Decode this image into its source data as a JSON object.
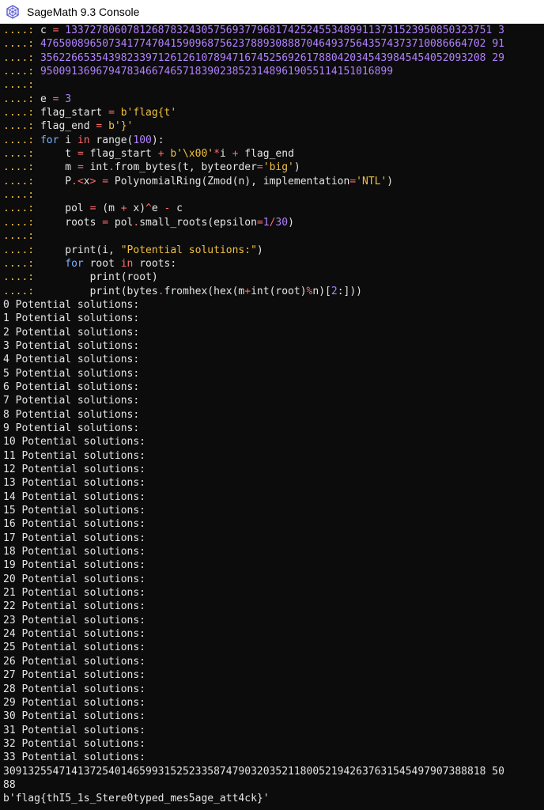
{
  "window": {
    "title": "SageMath 9.3 Console",
    "icon": "sagemath-icon"
  },
  "colors": {
    "background": "#0c0c0c",
    "text": "#e6e6e6",
    "prompt": "#f0c040",
    "number": "#b281ff",
    "string": "#f0c040",
    "keyword": "#7fb2ff",
    "operator": "#ff6b6b"
  },
  "console_lines": [
    {
      "prompt": "....: ",
      "tokens": [
        [
          "ident",
          "c "
        ],
        [
          "op",
          "="
        ],
        [
          "ident",
          " "
        ],
        [
          "num",
          "133727806078126878324305756937796817425245534899113731523950850323751 3"
        ]
      ]
    },
    {
      "prompt": "....: ",
      "tokens": [
        [
          "num",
          "476500896507341774704159096875623788930888704649375643574373710086664702 91"
        ]
      ]
    },
    {
      "prompt": "....: ",
      "tokens": [
        [
          "num",
          "356226653543982339712612610789471674525692617880420345439845454052093208 29"
        ]
      ]
    },
    {
      "prompt": "....: ",
      "tokens": [
        [
          "num",
          "950091369679478346674657183902385231489619055114151016899"
        ]
      ]
    },
    {
      "prompt": "....: ",
      "tokens": []
    },
    {
      "prompt": "....: ",
      "tokens": [
        [
          "ident",
          "e "
        ],
        [
          "op",
          "="
        ],
        [
          "ident",
          " "
        ],
        [
          "num",
          "3"
        ]
      ]
    },
    {
      "prompt": "....: ",
      "tokens": [
        [
          "ident",
          "flag_start "
        ],
        [
          "op",
          "="
        ],
        [
          "ident",
          " "
        ],
        [
          "str",
          "b'flag{t'"
        ]
      ]
    },
    {
      "prompt": "....: ",
      "tokens": [
        [
          "ident",
          "flag_end "
        ],
        [
          "op",
          "="
        ],
        [
          "ident",
          " "
        ],
        [
          "str",
          "b'}'"
        ]
      ]
    },
    {
      "prompt": "....: ",
      "tokens": [
        [
          "kw",
          "for"
        ],
        [
          "ident",
          " i "
        ],
        [
          "op",
          "in"
        ],
        [
          "ident",
          " range("
        ],
        [
          "num",
          "100"
        ],
        [
          "ident",
          "):"
        ]
      ]
    },
    {
      "prompt": "....: ",
      "tokens": [
        [
          "ident",
          "    t "
        ],
        [
          "op",
          "="
        ],
        [
          "ident",
          " flag_start "
        ],
        [
          "op",
          "+"
        ],
        [
          "ident",
          " "
        ],
        [
          "str",
          "b'\\x00'"
        ],
        [
          "op",
          "*"
        ],
        [
          "ident",
          "i "
        ],
        [
          "op",
          "+"
        ],
        [
          "ident",
          " flag_end"
        ]
      ]
    },
    {
      "prompt": "....: ",
      "tokens": [
        [
          "ident",
          "    m "
        ],
        [
          "op",
          "="
        ],
        [
          "ident",
          " int"
        ],
        [
          "op",
          "."
        ],
        [
          "ident",
          "from_bytes(t, byteorder"
        ],
        [
          "op",
          "="
        ],
        [
          "str",
          "'big'"
        ],
        [
          "ident",
          ")"
        ]
      ]
    },
    {
      "prompt": "....: ",
      "tokens": [
        [
          "ident",
          "    P"
        ],
        [
          "op",
          "."
        ],
        [
          "op",
          "<"
        ],
        [
          "ident",
          "x"
        ],
        [
          "op",
          ">"
        ],
        [
          "ident",
          " "
        ],
        [
          "op",
          "="
        ],
        [
          "ident",
          " PolynomialRing(Zmod(n), implementation"
        ],
        [
          "op",
          "="
        ],
        [
          "str",
          "'NTL'"
        ],
        [
          "ident",
          ")"
        ]
      ]
    },
    {
      "prompt": "....: ",
      "tokens": []
    },
    {
      "prompt": "....: ",
      "tokens": [
        [
          "ident",
          "    pol "
        ],
        [
          "op",
          "="
        ],
        [
          "ident",
          " (m "
        ],
        [
          "op",
          "+"
        ],
        [
          "ident",
          " x)"
        ],
        [
          "op",
          "^"
        ],
        [
          "ident",
          "e "
        ],
        [
          "op",
          "-"
        ],
        [
          "ident",
          " c"
        ]
      ]
    },
    {
      "prompt": "....: ",
      "tokens": [
        [
          "ident",
          "    roots "
        ],
        [
          "op",
          "="
        ],
        [
          "ident",
          " pol"
        ],
        [
          "op",
          "."
        ],
        [
          "ident",
          "small_roots(epsilon"
        ],
        [
          "op",
          "="
        ],
        [
          "num",
          "1"
        ],
        [
          "op",
          "/"
        ],
        [
          "num",
          "30"
        ],
        [
          "ident",
          ")"
        ]
      ]
    },
    {
      "prompt": "....: ",
      "tokens": []
    },
    {
      "prompt": "....: ",
      "tokens": [
        [
          "ident",
          "    print(i, "
        ],
        [
          "str",
          "\"Potential solutions:\""
        ],
        [
          "ident",
          ")"
        ]
      ]
    },
    {
      "prompt": "....: ",
      "tokens": [
        [
          "ident",
          "    "
        ],
        [
          "kw",
          "for"
        ],
        [
          "ident",
          " root "
        ],
        [
          "op",
          "in"
        ],
        [
          "ident",
          " roots:"
        ]
      ]
    },
    {
      "prompt": "....: ",
      "tokens": [
        [
          "ident",
          "        print(root)"
        ]
      ]
    },
    {
      "prompt": "....: ",
      "tokens": [
        [
          "ident",
          "        print(bytes"
        ],
        [
          "op",
          "."
        ],
        [
          "ident",
          "fromhex(hex(m"
        ],
        [
          "op",
          "+"
        ],
        [
          "ident",
          "int(root)"
        ],
        [
          "op",
          "%"
        ],
        [
          "ident",
          "n)["
        ],
        [
          "num",
          "2"
        ],
        [
          "ident",
          ":]))"
        ]
      ]
    },
    {
      "prompt": "",
      "tokens": [
        [
          "ident",
          "0 Potential solutions:"
        ]
      ]
    },
    {
      "prompt": "",
      "tokens": [
        [
          "ident",
          "1 Potential solutions:"
        ]
      ]
    },
    {
      "prompt": "",
      "tokens": [
        [
          "ident",
          "2 Potential solutions:"
        ]
      ]
    },
    {
      "prompt": "",
      "tokens": [
        [
          "ident",
          "3 Potential solutions:"
        ]
      ]
    },
    {
      "prompt": "",
      "tokens": [
        [
          "ident",
          "4 Potential solutions:"
        ]
      ]
    },
    {
      "prompt": "",
      "tokens": [
        [
          "ident",
          "5 Potential solutions:"
        ]
      ]
    },
    {
      "prompt": "",
      "tokens": [
        [
          "ident",
          "6 Potential solutions:"
        ]
      ]
    },
    {
      "prompt": "",
      "tokens": [
        [
          "ident",
          "7 Potential solutions:"
        ]
      ]
    },
    {
      "prompt": "",
      "tokens": [
        [
          "ident",
          "8 Potential solutions:"
        ]
      ]
    },
    {
      "prompt": "",
      "tokens": [
        [
          "ident",
          "9 Potential solutions:"
        ]
      ]
    },
    {
      "prompt": "",
      "tokens": [
        [
          "ident",
          "10 Potential solutions:"
        ]
      ]
    },
    {
      "prompt": "",
      "tokens": [
        [
          "ident",
          "11 Potential solutions:"
        ]
      ]
    },
    {
      "prompt": "",
      "tokens": [
        [
          "ident",
          "12 Potential solutions:"
        ]
      ]
    },
    {
      "prompt": "",
      "tokens": [
        [
          "ident",
          "13 Potential solutions:"
        ]
      ]
    },
    {
      "prompt": "",
      "tokens": [
        [
          "ident",
          "14 Potential solutions:"
        ]
      ]
    },
    {
      "prompt": "",
      "tokens": [
        [
          "ident",
          "15 Potential solutions:"
        ]
      ]
    },
    {
      "prompt": "",
      "tokens": [
        [
          "ident",
          "16 Potential solutions:"
        ]
      ]
    },
    {
      "prompt": "",
      "tokens": [
        [
          "ident",
          "17 Potential solutions:"
        ]
      ]
    },
    {
      "prompt": "",
      "tokens": [
        [
          "ident",
          "18 Potential solutions:"
        ]
      ]
    },
    {
      "prompt": "",
      "tokens": [
        [
          "ident",
          "19 Potential solutions:"
        ]
      ]
    },
    {
      "prompt": "",
      "tokens": [
        [
          "ident",
          "20 Potential solutions:"
        ]
      ]
    },
    {
      "prompt": "",
      "tokens": [
        [
          "ident",
          "21 Potential solutions:"
        ]
      ]
    },
    {
      "prompt": "",
      "tokens": [
        [
          "ident",
          "22 Potential solutions:"
        ]
      ]
    },
    {
      "prompt": "",
      "tokens": [
        [
          "ident",
          "23 Potential solutions:"
        ]
      ]
    },
    {
      "prompt": "",
      "tokens": [
        [
          "ident",
          "24 Potential solutions:"
        ]
      ]
    },
    {
      "prompt": "",
      "tokens": [
        [
          "ident",
          "25 Potential solutions:"
        ]
      ]
    },
    {
      "prompt": "",
      "tokens": [
        [
          "ident",
          "26 Potential solutions:"
        ]
      ]
    },
    {
      "prompt": "",
      "tokens": [
        [
          "ident",
          "27 Potential solutions:"
        ]
      ]
    },
    {
      "prompt": "",
      "tokens": [
        [
          "ident",
          "28 Potential solutions:"
        ]
      ]
    },
    {
      "prompt": "",
      "tokens": [
        [
          "ident",
          "29 Potential solutions:"
        ]
      ]
    },
    {
      "prompt": "",
      "tokens": [
        [
          "ident",
          "30 Potential solutions:"
        ]
      ]
    },
    {
      "prompt": "",
      "tokens": [
        [
          "ident",
          "31 Potential solutions:"
        ]
      ]
    },
    {
      "prompt": "",
      "tokens": [
        [
          "ident",
          "32 Potential solutions:"
        ]
      ]
    },
    {
      "prompt": "",
      "tokens": [
        [
          "ident",
          "33 Potential solutions:"
        ]
      ]
    },
    {
      "prompt": "",
      "tokens": [
        [
          "ident",
          "309132554714137254014659931525233587479032035211800521942637631545497907388818 50"
        ]
      ]
    },
    {
      "prompt": "",
      "tokens": [
        [
          "ident",
          "88"
        ]
      ]
    },
    {
      "prompt": "",
      "tokens": [
        [
          "ident",
          "b'flag{thI5_1s_Stere0typed_mes5age_att4ck}'"
        ]
      ]
    }
  ]
}
